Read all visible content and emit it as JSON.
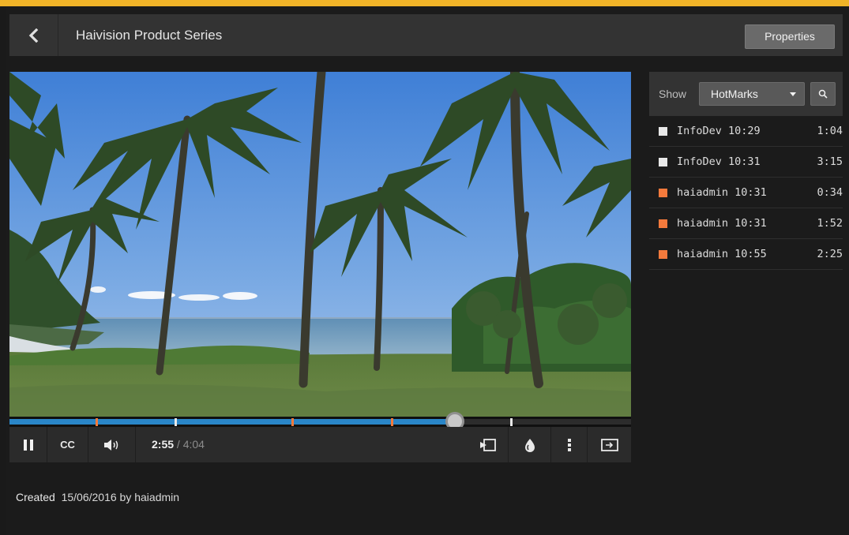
{
  "header": {
    "title": "Haivision Product Series",
    "properties_label": "Properties"
  },
  "player": {
    "current_time": "2:55",
    "separator": " / ",
    "total_time": "4:04",
    "progress": 0.7172,
    "cc_label": "CC",
    "seek_markers": [
      {
        "position": 0.1393,
        "kind": "user"
      },
      {
        "position": 0.2664,
        "kind": "info"
      },
      {
        "position": 0.4549,
        "kind": "user"
      },
      {
        "position": 0.6148,
        "kind": "user"
      },
      {
        "position": 0.8074,
        "kind": "info"
      }
    ]
  },
  "sidebar": {
    "show_label": "Show",
    "filter_value": "HotMarks",
    "hotmarks": [
      {
        "name": "InfoDev 10:29",
        "time": "1:04",
        "kind": "info"
      },
      {
        "name": "InfoDev 10:31",
        "time": "3:15",
        "kind": "info"
      },
      {
        "name": "haiadmin 10:31",
        "time": "0:34",
        "kind": "user"
      },
      {
        "name": "haiadmin 10:31",
        "time": "1:52",
        "kind": "user"
      },
      {
        "name": "haiadmin 10:55",
        "time": "2:25",
        "kind": "user"
      }
    ]
  },
  "footer": {
    "created_label": "Created",
    "created_value": "15/06/2016 by haiadmin"
  },
  "colors": {
    "accent": "#2a86c8",
    "info_marker": "#e8e8e8",
    "user_marker": "#f47a3c",
    "top_strip": "#f1b428"
  },
  "icons": [
    "back-chevron-icon",
    "search-icon",
    "pause-icon",
    "volume-icon",
    "share-icon",
    "hotmark-drop-icon",
    "more-vertical-icon",
    "popout-icon"
  ]
}
